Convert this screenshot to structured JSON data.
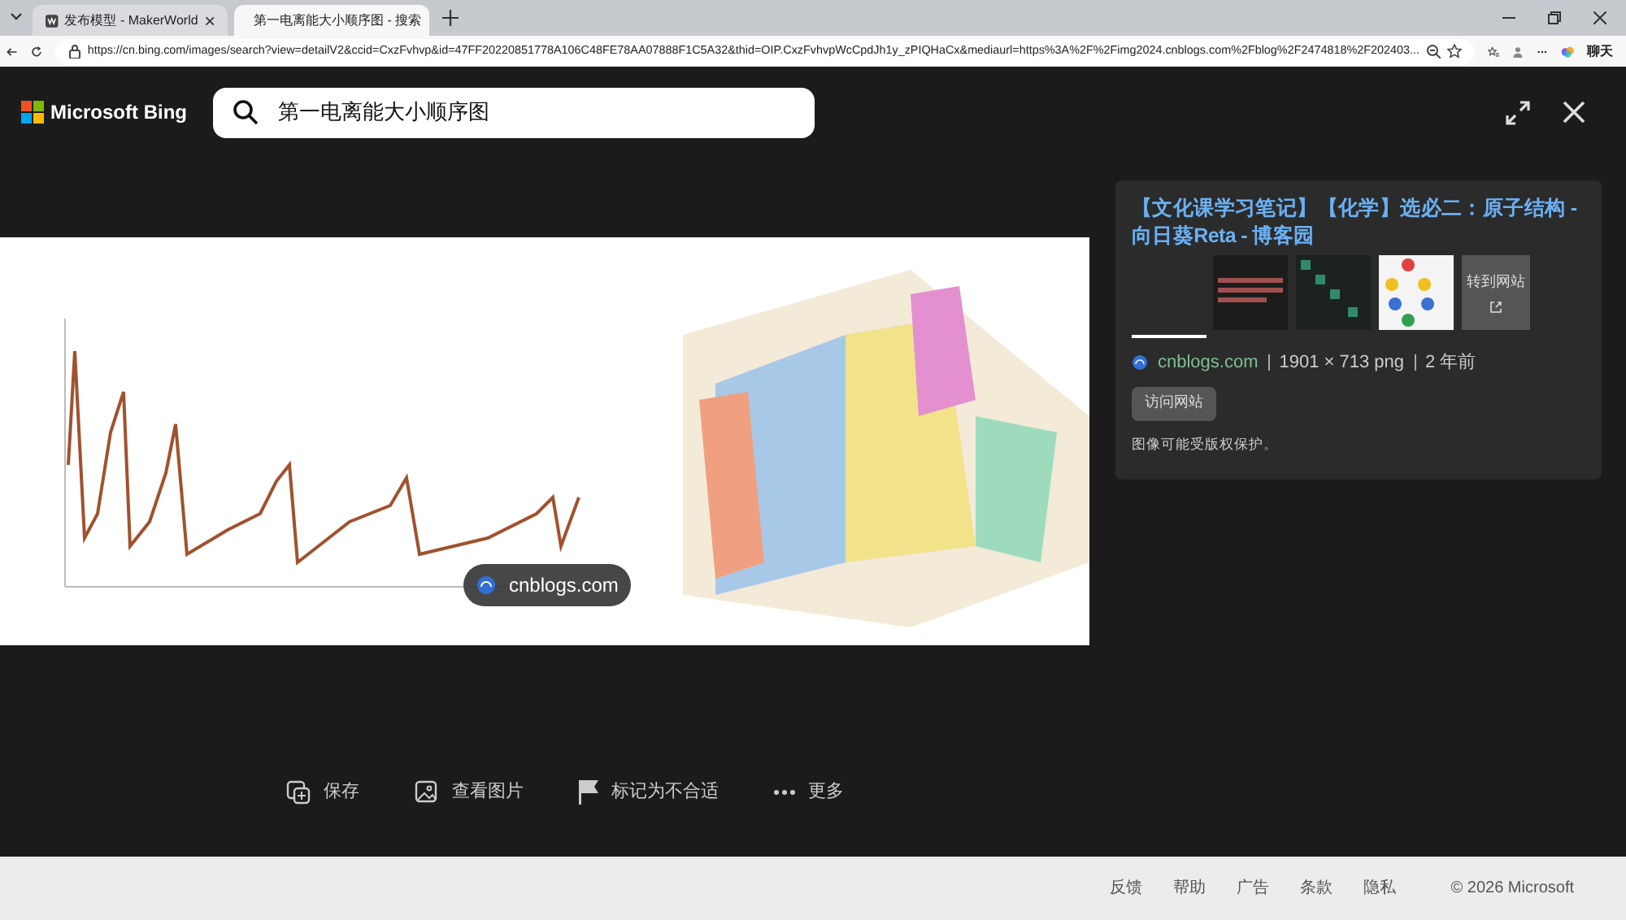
{
  "tabs": [
    {
      "title": "发布模型 - MakerWorld",
      "selected": false
    },
    {
      "title": "第一电离能大小顺序图 - 搜索",
      "selected": true
    }
  ],
  "address_bar": {
    "url": "https://cn.bing.com/images/search?view=detailV2&ccid=CxzFvhvp&id=47FF20220851778A106C48FE78AA07888F1C5A32&thid=OIP.CxzFvhvpWcCpdJh1y_zPIQHaCx&mediaurl=https%3A%2F%2Fimg2024.cnblogs.com%2Fblog%2F2474818%2F202403..."
  },
  "copilot_label": "聊天",
  "header": {
    "logo": "Microsoft Bing",
    "search_value": "第一电离能大小顺序图"
  },
  "viewer": {
    "source_badge": "cnblogs.com"
  },
  "details": {
    "title": "【文化课学习笔记】【化学】选必二：原子结构 - 向日葵Reta - 博客园",
    "thumbnails": [
      {
        "selected": true
      },
      {
        "selected": false
      },
      {
        "selected": false
      }
    ],
    "goto_site": "转到网站",
    "domain": "cnblogs.com",
    "dimensions": "1901 × 713 png",
    "age": "2 年前",
    "visit_button": "访问网站",
    "notice": "图像可能受版权保护。"
  },
  "actions": [
    {
      "kind": "save",
      "label": "保存"
    },
    {
      "kind": "view",
      "label": "查看图片"
    },
    {
      "kind": "flag",
      "label": "标记为不合适"
    },
    {
      "kind": "more",
      "label": "更多"
    }
  ],
  "footer": {
    "links": [
      "反馈",
      "帮助",
      "广告",
      "条款",
      "隐私"
    ],
    "copyright": "© 2026 Microsoft"
  }
}
